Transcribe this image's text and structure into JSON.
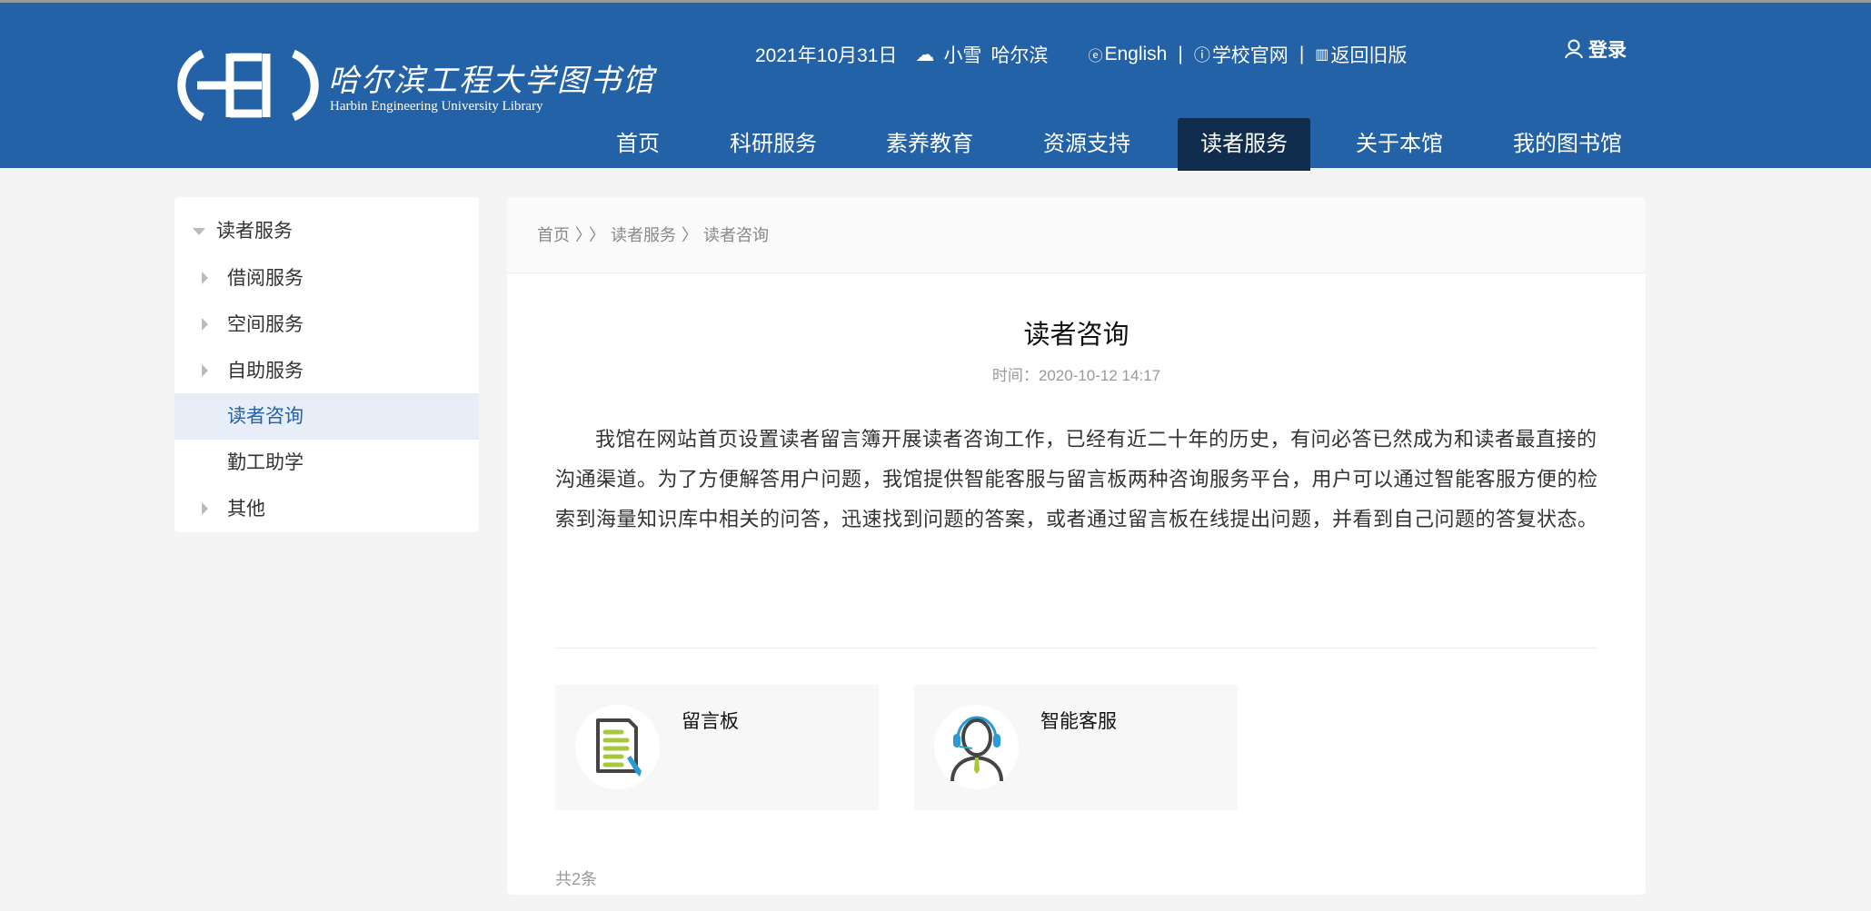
{
  "header": {
    "logo_cn": "哈尔滨工程大学图书馆",
    "logo_en": "Harbin Engineering University Library",
    "date": "2021年10月31日",
    "weather": "小雪",
    "city": "哈尔滨",
    "links": [
      "English",
      "学校官网",
      "返回旧版"
    ],
    "login": "登录",
    "nav": [
      "首页",
      "科研服务",
      "素养教育",
      "资源支持",
      "读者服务",
      "关于本馆",
      "我的图书馆"
    ],
    "active_nav": "读者服务",
    "colors": {
      "header_bg": "#2462a8",
      "active_bg": "#112d4e"
    }
  },
  "sidebar": {
    "title": "读者服务",
    "items": [
      {
        "label": "借阅服务",
        "expandable": true
      },
      {
        "label": "空间服务",
        "expandable": true
      },
      {
        "label": "自助服务",
        "expandable": true
      },
      {
        "label": "读者咨询",
        "expandable": false,
        "active": true
      },
      {
        "label": "勤工助学",
        "expandable": false
      },
      {
        "label": "其他",
        "expandable": true
      }
    ]
  },
  "breadcrumb": [
    "首页",
    "读者服务",
    "读者咨询"
  ],
  "article": {
    "title": "读者咨询",
    "time": "时间：2020-10-12 14:17",
    "body": "我馆在网站首页设置读者留言簿开展读者咨询工作，已经有近二十年的历史，有问必答已然成为和读者最直接的沟通渠道。为了方便解答用户问题，我馆提供智能客服与留言板两种咨询服务平台，用户可以通过智能客服方便的检索到海量知识库中相关的问答，迅速找到问题的答案，或者通过留言板在线提出问题，并看到自己问题的答复状态。"
  },
  "cards": [
    {
      "label": "留言板",
      "icon": "message-board-icon"
    },
    {
      "label": "智能客服",
      "icon": "customer-service-icon"
    }
  ],
  "count": "共2条"
}
